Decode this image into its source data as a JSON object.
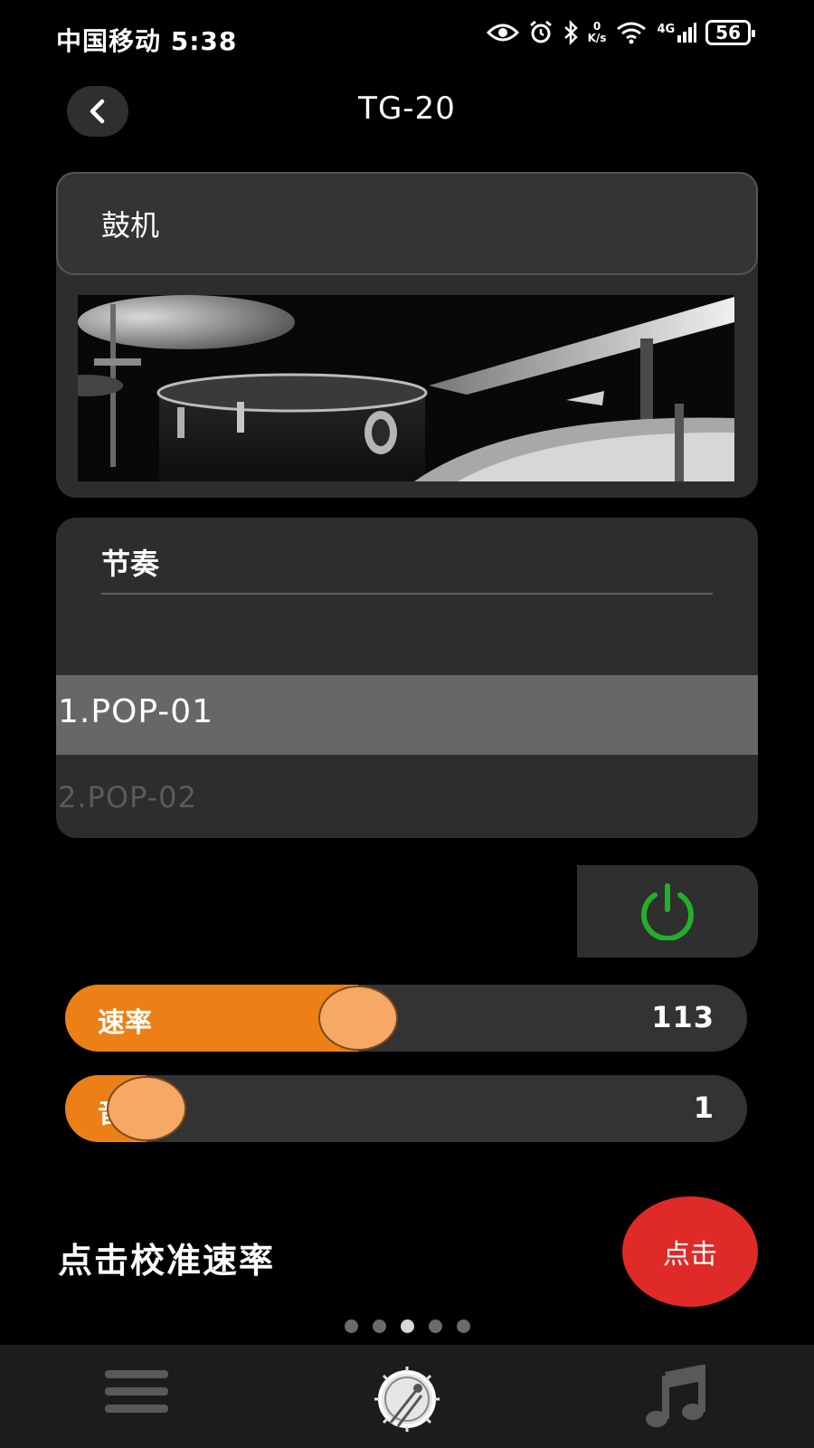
{
  "status_bar": {
    "carrier_time": "中国移动 5:38",
    "net_speed_value": "0",
    "net_speed_unit": "K/s",
    "network": "4G",
    "battery": "56"
  },
  "header": {
    "title": "TG-20",
    "back_icon": "chevron-left-icon"
  },
  "drum_machine": {
    "label": "鼓机"
  },
  "rhythm": {
    "label": "节奏",
    "selected": "1.POP-01",
    "next": "2.POP-02"
  },
  "power": {
    "icon": "power-icon",
    "color": "#22b02a"
  },
  "tempo": {
    "label": "速率",
    "value": "113",
    "fill_fraction": 0.43
  },
  "volume": {
    "label": "音量",
    "value": "1",
    "fill_fraction": 0.12
  },
  "calibrate": {
    "label": "点击校准速率",
    "button": "点击"
  },
  "pager": {
    "count": 5,
    "active_index": 2
  },
  "bottom_nav": {
    "items": [
      "menu-icon",
      "drum-icon",
      "music-note-icon"
    ]
  },
  "colors": {
    "accent": "#ec8017",
    "knob": "#f5a964",
    "tap_button": "#e02a27"
  }
}
